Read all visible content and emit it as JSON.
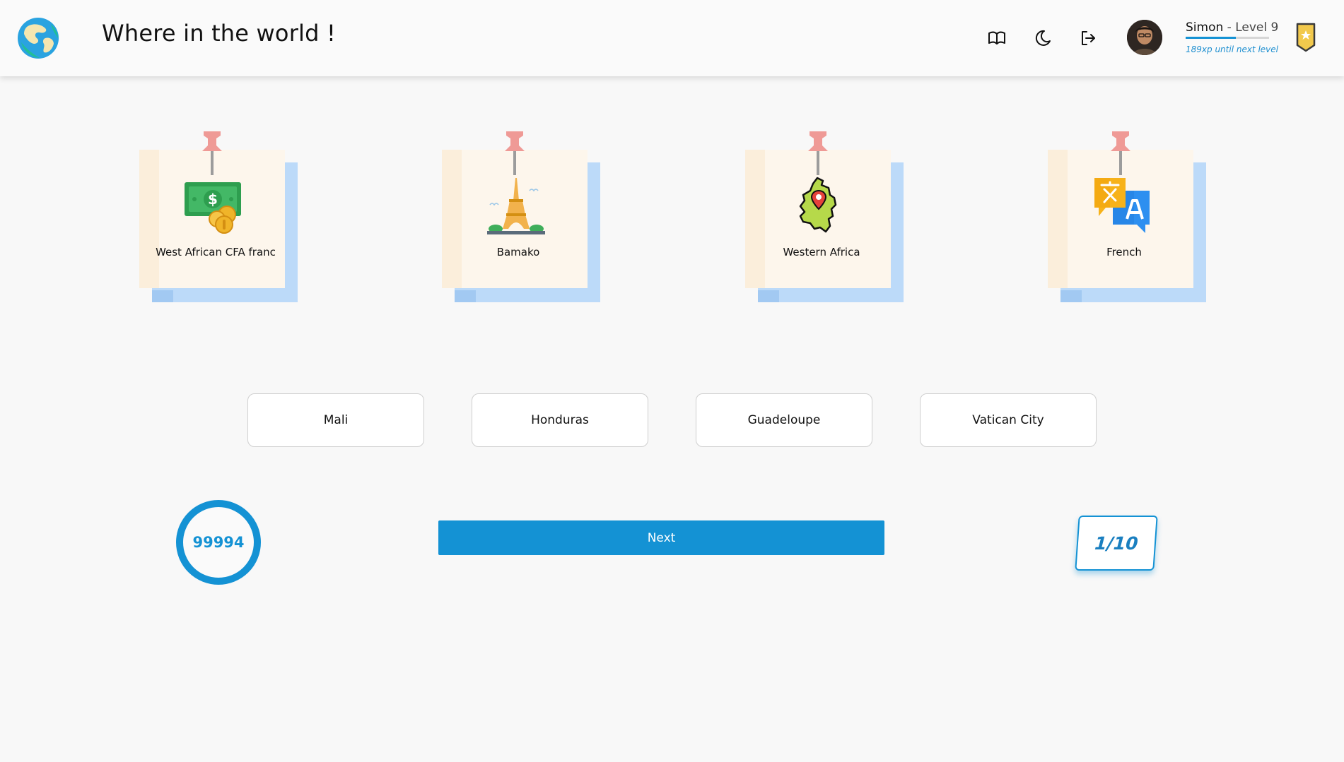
{
  "app": {
    "title": "Where in the world !"
  },
  "header": {
    "icons": [
      "book-icon",
      "moon-icon",
      "logout-icon"
    ],
    "user": {
      "name": "Simon",
      "level_text": " - Level 9",
      "xp_text": "189xp until next level",
      "xp_progress": 0.6
    }
  },
  "clues": [
    {
      "label": "West African CFA franc",
      "icon": "money-icon"
    },
    {
      "label": "Bamako",
      "icon": "eiffel-tower-icon"
    },
    {
      "label": "Western Africa",
      "icon": "map-pin-icon"
    },
    {
      "label": "French",
      "icon": "translate-icon"
    }
  ],
  "choices": [
    "Mali",
    "Honduras",
    "Guadeloupe",
    "Vatican City"
  ],
  "controls": {
    "timer": "99994",
    "next_label": "Next",
    "progress": "1/10"
  },
  "colors": {
    "accent": "#1492d4",
    "card_front": "#fdf6ec",
    "card_back": "#bcdaf9",
    "pin": "#ef9a96"
  }
}
